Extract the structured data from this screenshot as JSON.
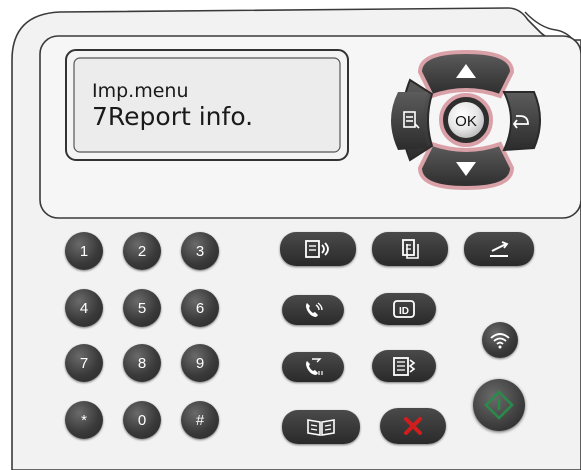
{
  "display": {
    "line1": "Imp.menu",
    "line2": "7Report info."
  },
  "nav": {
    "ok_label": "OK"
  },
  "keypad": [
    "1",
    "2",
    "3",
    "4",
    "5",
    "6",
    "7",
    "8",
    "9",
    "*",
    "0",
    "#"
  ],
  "icons": {
    "up": "up-arrow-icon",
    "down": "down-arrow-icon",
    "back": "back-arrow-icon",
    "menu": "menu-icon",
    "copy_mode": "copy-mode-icon",
    "copy": "copy-icon",
    "scan": "scan-icon",
    "fax_call": "fax-call-icon",
    "id_copy": "id-copy-icon",
    "wifi": "wifi-icon",
    "redial": "redial-icon",
    "speed_dial": "speed-dial-icon",
    "book": "book-copy-icon",
    "cancel": "cancel-icon",
    "start": "start-icon"
  },
  "colors": {
    "panel": "#ededed",
    "lcd": "#ececec",
    "key": "#3a3a3a",
    "highlight": "#d9a0a8",
    "cancel": "#d21d1d",
    "start": "#2a8a4a"
  }
}
